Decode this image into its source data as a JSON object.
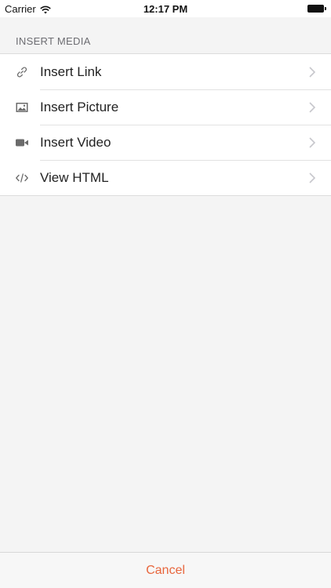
{
  "status_bar": {
    "carrier": "Carrier",
    "time": "12:17 PM",
    "wifi_icon": "wifi-icon",
    "battery_icon": "battery-icon"
  },
  "section": {
    "header": "INSERT MEDIA"
  },
  "menu": {
    "items": [
      {
        "label": "Insert Link",
        "icon": "link-icon"
      },
      {
        "label": "Insert Picture",
        "icon": "picture-icon"
      },
      {
        "label": "Insert Video",
        "icon": "video-icon"
      },
      {
        "label": "View HTML",
        "icon": "code-icon"
      }
    ]
  },
  "footer": {
    "cancel_label": "Cancel"
  },
  "colors": {
    "accent": "#e8663d",
    "background": "#f4f4f4",
    "icon": "#6b6b6b"
  }
}
